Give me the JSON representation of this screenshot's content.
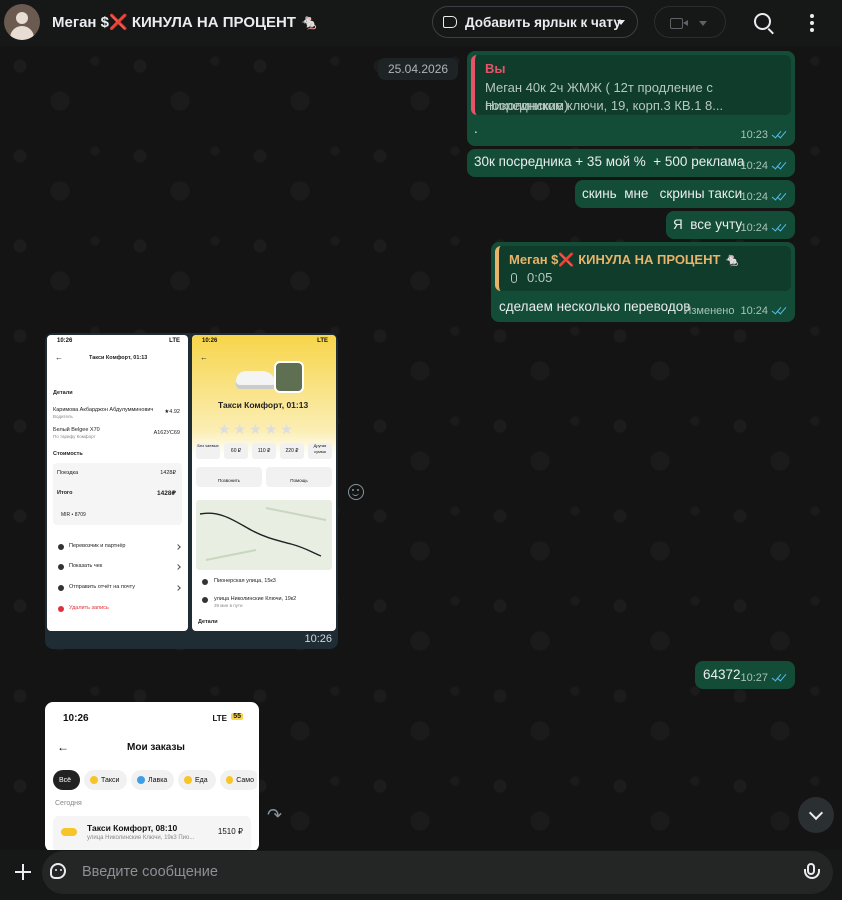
{
  "header": {
    "title_prefix": "Меган $",
    "title_x": "❌",
    "title_suffix": " КИНУЛА НА ПРОЦЕНТ 🐁",
    "label_button": "Добавить ярлык к чату"
  },
  "date_pill": "25.04.2026",
  "messages": {
    "m1": {
      "quote_author": "Вы",
      "quote_line1": "Меган 40к 2ч ЖМЖ ( 12т продление с посредником)",
      "quote_line2": "Николинские ключи, 19, корп.3 КВ.1 8...",
      "text": ".",
      "time": "10:23"
    },
    "m2": {
      "text": "30к посредника + 35 мой %  + 500 реклама",
      "time": "10:24"
    },
    "m3": {
      "text": "скинь  мне   скрины такси",
      "time": "10:24"
    },
    "m4": {
      "text": "Я  все учту",
      "time": "10:24"
    },
    "m5": {
      "quote_author_prefix": "Меган $",
      "quote_author_x": "❌",
      "quote_author_suffix": " КИНУЛА НА ПРОЦЕНТ 🐁",
      "voice_duration": "0:05",
      "text": "сделаем несколько переводов",
      "edited": "Изменено",
      "time": "10:24"
    },
    "m6": {
      "text": "64372",
      "time": "10:27"
    }
  },
  "image_group": {
    "time": "10:26",
    "left": {
      "status_time": "10:26",
      "status_right": "LTE",
      "title": "Такси Комфорт, 01:13",
      "details_label": "Детали",
      "driver_name": "Каримова Акбарджон Абдулумминович",
      "driver_role": "Водитель",
      "rating": "★4.92",
      "car": "Белый Belgee X70",
      "car_tariff": "По тарифу Комфорт",
      "plate": "А162УС69",
      "cost_label": "Стоимость",
      "trip_label": "Поездка",
      "trip_value": "1428₽",
      "total_label": "Итого",
      "total_value": "1428₽",
      "card": "MIR • 8709",
      "menu1": "Перевозчик и партнёр",
      "menu2": "Показать чек",
      "menu3": "Отправить отчёт на почту",
      "menu4": "Удалить запись"
    },
    "right": {
      "status_time": "10:26",
      "status_right": "LTE",
      "title": "Такси Комфорт, 01:13",
      "tip1": "Без чаевых",
      "tip2": "60 ₽",
      "tip3": "110 ₽",
      "tip4": "220 ₽",
      "tip5": "Другая сумма",
      "call": "Позвонить",
      "help": "Помощь",
      "from": "Пионерская улица, 15к3",
      "to": "улица Николинские Ключи, 19к2",
      "to_sub": "39 мин в пути",
      "details": "Детали"
    }
  },
  "orders_shot": {
    "status_time": "10:26",
    "status_right": "LTE",
    "battery": "55",
    "title": "Мои заказы",
    "chips": [
      "Всё",
      "Такси",
      "Лавка",
      "Еда",
      "Само"
    ],
    "today": "Сегодня",
    "order_title": "Такси Комфорт, 08:10",
    "order_sub": "улица Николинские Ключи, 19к3 Пио...",
    "order_price": "1510 ₽"
  },
  "composer": {
    "placeholder": "Введите сообщение"
  },
  "colors": {
    "bubble_out": "#144d37",
    "quote_accent": "#e7546a",
    "read_ticks": "#53bdeb"
  }
}
